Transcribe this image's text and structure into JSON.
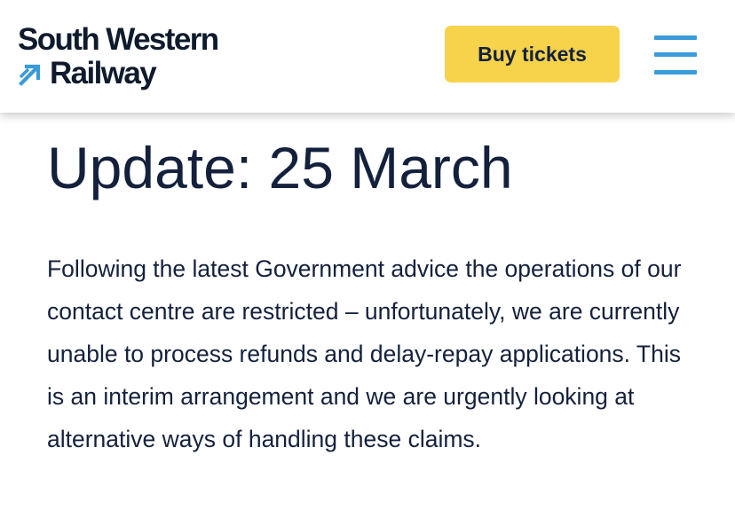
{
  "header": {
    "logo_line1": "South Western",
    "logo_line2": "Railway",
    "logo_arrow_icon": "diagonal-arrow-icon",
    "buy_tickets_label": "Buy tickets",
    "menu_icon": "hamburger-menu-icon",
    "accent_color": "#3b9ad9",
    "button_color": "#f7d24b"
  },
  "article": {
    "title": "Update: 25 March",
    "body": "Following the latest Government advice the operations of our contact centre are restricted – unfortunately, we are currently unable to process refunds and delay-repay applications. This is an interim arrangement and we are urgently looking at alternative ways of handling these claims."
  }
}
